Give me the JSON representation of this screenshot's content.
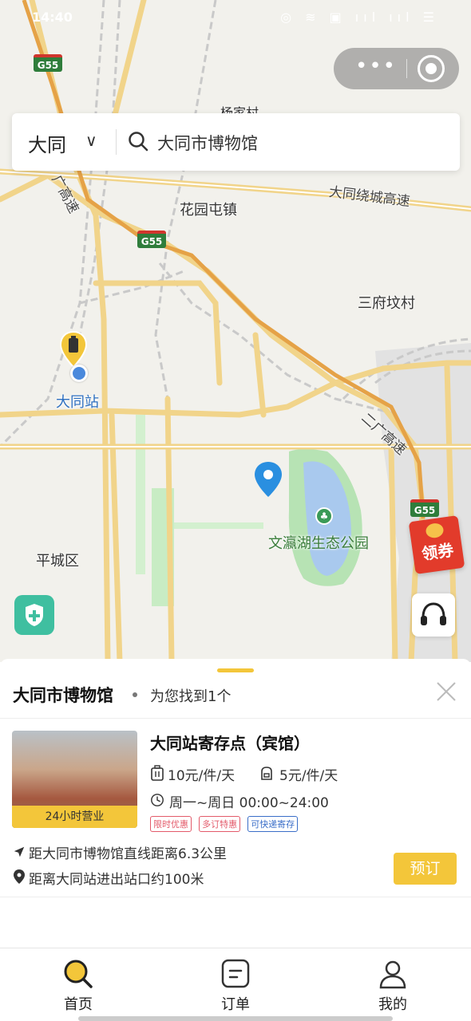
{
  "status_bar": {
    "time": "14:40",
    "icons": "◎ ≋ ▣ ııl ııl ☰"
  },
  "capsule": {
    "more": "•••",
    "close_icon": "target-icon"
  },
  "search": {
    "city": "大同",
    "query": "大同市博物馆"
  },
  "map": {
    "places": {
      "huayuan": "花园屯镇",
      "sanfu": "三府坟村",
      "datong_station": "大同站",
      "wenying_park": "文瀛湖生态公园",
      "pingcheng": "平城区",
      "top_partial": "杨家村"
    },
    "roads": {
      "ring": "大同绕城高速",
      "erguang_top": "广高速",
      "erguang_right": "二广高速"
    },
    "shields": [
      "G55",
      "G55",
      "G55"
    ]
  },
  "buttons": {
    "coupon": "领券"
  },
  "panel": {
    "title": "大同市博物馆",
    "result_count": "为您找到1个"
  },
  "result": {
    "name": "大同站寄存点（宾馆）",
    "badge": "24小时营业",
    "price_large": "10元/件/天",
    "price_small": "5元/件/天",
    "hours": "周一~周日 00:00~24:00",
    "tags": [
      "限时优惠",
      "多订特惠",
      "可快递寄存"
    ],
    "distance_line": "距大同市博物馆直线距离6.3公里",
    "station_line": "距离大同站进出站口约100米",
    "book_label": "预订"
  },
  "tabs": [
    {
      "label": "首页",
      "icon": "search-icon"
    },
    {
      "label": "订单",
      "icon": "order-icon"
    },
    {
      "label": "我的",
      "icon": "user-icon"
    }
  ],
  "colors": {
    "accent": "#f3c63a",
    "coupon_red": "#e23b2b",
    "shield_teal": "#3fbfa0"
  }
}
